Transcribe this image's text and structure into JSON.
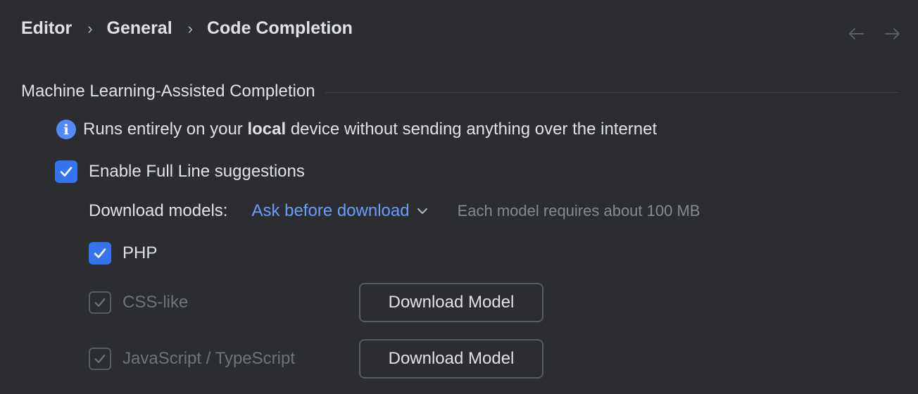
{
  "breadcrumb": {
    "items": [
      "Editor",
      "General",
      "Code Completion"
    ],
    "separator": "›"
  },
  "nav": {
    "back_icon": "arrow-left-icon",
    "forward_icon": "arrow-right-icon"
  },
  "section": {
    "title": "Machine Learning-Assisted Completion"
  },
  "info": {
    "icon": "info-icon",
    "text_before": "Runs entirely on your ",
    "text_bold": "local",
    "text_after": " device without sending anything over the internet"
  },
  "full_line": {
    "label": "Enable Full Line suggestions",
    "checked": true
  },
  "download_models": {
    "label": "Download models:",
    "selected": "Ask before download",
    "hint": "Each model requires about 100 MB"
  },
  "languages": [
    {
      "label": "PHP",
      "checked": true,
      "enabled": true
    },
    {
      "label": "CSS-like",
      "checked": true,
      "enabled": false,
      "button": "Download Model"
    },
    {
      "label": "JavaScript / TypeScript",
      "checked": true,
      "enabled": false,
      "button": "Download Model"
    }
  ],
  "colors": {
    "background": "#2b2d30",
    "accent": "#3574f0",
    "link": "#6c9cf9"
  }
}
